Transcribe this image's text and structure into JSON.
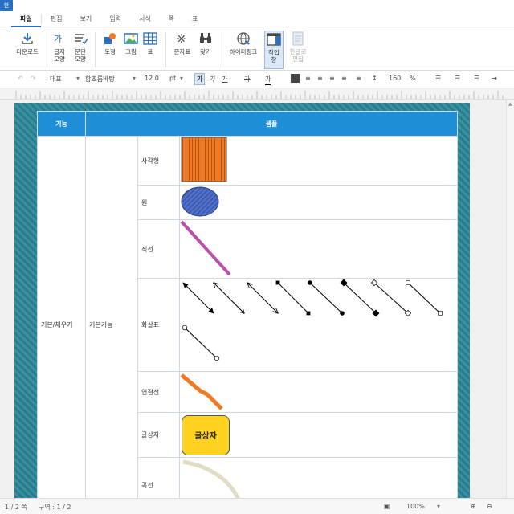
{
  "app": {
    "icon_label": "한"
  },
  "menu": {
    "tabs": [
      "파일",
      "편집",
      "보기",
      "입력",
      "서식",
      "쪽",
      "표"
    ]
  },
  "ribbon": {
    "download": "다운로드",
    "char_shape": [
      "글자",
      "모양"
    ],
    "para_shape": [
      "문단",
      "모양"
    ],
    "shape": "도형",
    "picture": "그림",
    "table": "표",
    "symbol": "문자표",
    "find": "찾기",
    "hyperlink": "하이퍼링크",
    "workspace": [
      "작업",
      "창"
    ],
    "open_hangul": [
      "한글로",
      "편집"
    ]
  },
  "format": {
    "style": "대표",
    "font": "함초롬바탕",
    "size": "12.0",
    "size_unit": "pt",
    "bold": "가",
    "italic": "가",
    "underline": "가",
    "strike": "가",
    "color": "가",
    "line_spacing": "160",
    "line_spacing_unit": "%"
  },
  "table": {
    "header": {
      "col1": "기능",
      "col2": "샘플"
    },
    "category": "기본/채우기",
    "subcategory": "기본기능",
    "rows": [
      {
        "label": "사각형"
      },
      {
        "label": "원"
      },
      {
        "label": "직선"
      },
      {
        "label": "화살표"
      },
      {
        "label": "연결선"
      },
      {
        "label": "글상자",
        "textbox_text": "글상자"
      },
      {
        "label": "곡선"
      }
    ]
  },
  "colors": {
    "accent": "#1e8fd6",
    "rect_fill": "#f07a24",
    "ellipse_fill": "#4f6fc9",
    "line_color": "#b94fae",
    "connector": "#f07a24",
    "textbox_fill": "#ffd21f",
    "curve": "#e3dcc4"
  },
  "status": {
    "page": "1 / 2 쪽",
    "section": "구역 : 1 / 2",
    "zoom": "100%"
  }
}
